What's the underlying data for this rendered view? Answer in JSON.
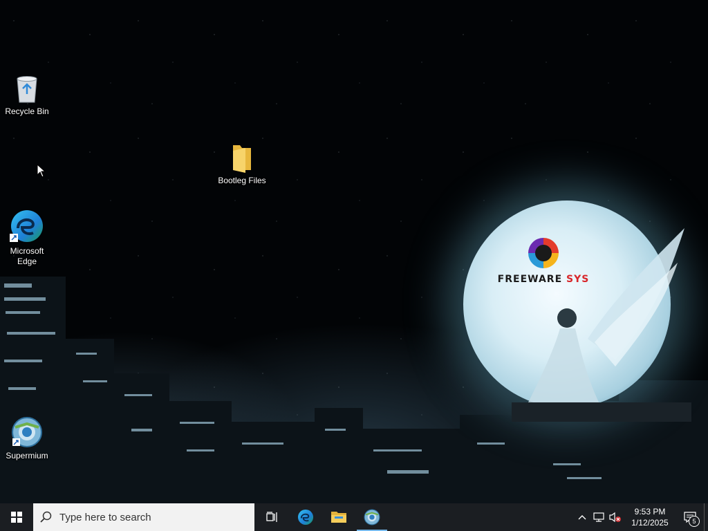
{
  "desktop": {
    "icons": [
      {
        "label": "Recycle Bin",
        "icon": "recycle-bin-icon"
      },
      {
        "label": "Bootleg Files",
        "icon": "folder-icon"
      },
      {
        "label": "Microsoft Edge",
        "icon": "edge-icon"
      },
      {
        "label": "Supermium",
        "icon": "supermium-icon"
      }
    ],
    "wallpaper_logo": {
      "part1": "FREEWARE ",
      "part2": "SYS"
    }
  },
  "taskbar": {
    "start_icon": "windows-start-icon",
    "search": {
      "placeholder": "Type here to search"
    },
    "pinned": [
      {
        "name": "task-view-icon"
      },
      {
        "name": "edge-icon"
      },
      {
        "name": "file-explorer-icon"
      },
      {
        "name": "supermium-icon",
        "active": true
      }
    ],
    "tray": {
      "time": "9:53 PM",
      "date": "1/12/2025",
      "notification_count": "5"
    }
  },
  "colors": {
    "taskbar_bg": "#1b1e22",
    "search_bg": "#f2f2f2",
    "active_indicator": "#76b9ed",
    "logo_red": "#d8262a"
  }
}
